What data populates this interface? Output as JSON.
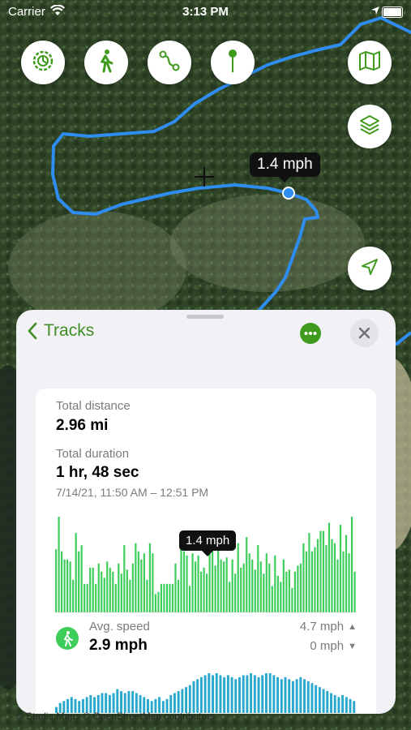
{
  "status_bar": {
    "carrier": "Carrier",
    "time": "3:13 PM"
  },
  "map": {
    "speed_tooltip": "1.4 mph",
    "attribution": "© Stadia Maps © OpenStreetMap contributors",
    "buttons": [
      {
        "name": "settings-icon"
      },
      {
        "name": "walk-icon"
      },
      {
        "name": "route-icon"
      },
      {
        "name": "pin-icon"
      },
      {
        "name": "map-icon"
      },
      {
        "name": "layers-icon"
      },
      {
        "name": "location-arrow-icon"
      }
    ]
  },
  "sheet": {
    "back_label": "Tracks",
    "total_distance_label": "Total distance",
    "total_distance": "2.96 mi",
    "total_duration_label": "Total duration",
    "total_duration": "1 hr, 48 sec",
    "date_range": "7/14/21, 11:50 AM – 12:51 PM",
    "chart_tooltip": "1.4 mph",
    "avg_speed_label": "Avg. speed",
    "avg_speed": "2.9 mph",
    "max_speed": "4.7 mph",
    "min_speed": "0 mph"
  },
  "colors": {
    "accent_green": "#3f8f24",
    "speed_bar": "#3dcd5a",
    "elevation_bar": "#28a8cc"
  },
  "chart_data": [
    {
      "type": "bar",
      "series": [
        {
          "values": [
            3.1,
            4.7,
            3.0,
            2.6,
            2.6,
            2.5,
            1.6,
            3.9,
            3.0,
            3.3,
            1.4,
            1.4,
            2.2,
            2.2,
            1.4,
            2.4,
            2.0,
            1.7,
            2.5,
            2.2,
            2.0,
            1.4,
            2.4,
            1.9,
            3.3,
            2.1,
            1.6,
            2.4,
            3.4,
            3.0,
            2.6,
            2.9,
            1.6,
            3.4,
            2.9,
            0.9,
            1.0,
            1.4,
            1.4,
            1.4,
            1.4,
            1.4,
            2.4,
            1.6,
            3.1,
            3.0,
            2.8,
            1.3,
            2.9,
            2.5,
            2.8,
            2.0,
            2.2,
            1.9,
            3.0,
            3.2,
            2.3,
            3.6,
            2.6,
            2.5,
            2.7,
            1.5,
            2.6,
            1.9,
            3.4,
            2.2,
            2.4,
            3.7,
            2.9,
            2.6,
            2.1,
            3.3,
            2.5,
            1.9,
            2.9,
            2.4,
            1.3,
            2.8,
            1.8,
            1.5,
            2.6,
            2.0,
            2.1,
            1.2,
            2.0,
            2.3,
            2.4,
            3.4,
            3.0,
            3.9,
            3.0,
            3.2,
            3.6,
            4.0,
            4.0,
            3.3,
            4.4,
            3.6,
            3.4,
            2.6,
            4.3,
            3.0,
            3.8,
            2.9,
            4.7,
            2.0
          ]
        }
      ]
    },
    {
      "type": "bar",
      "series": [
        {
          "values": [
            0.15,
            0.25,
            0.3,
            0.35,
            0.4,
            0.35,
            0.3,
            0.35,
            0.4,
            0.45,
            0.4,
            0.45,
            0.5,
            0.5,
            0.45,
            0.5,
            0.6,
            0.55,
            0.5,
            0.55,
            0.55,
            0.5,
            0.45,
            0.4,
            0.35,
            0.3,
            0.35,
            0.4,
            0.3,
            0.35,
            0.45,
            0.5,
            0.55,
            0.6,
            0.65,
            0.7,
            0.8,
            0.85,
            0.9,
            0.95,
            1.0,
            0.95,
            1.0,
            0.95,
            0.9,
            0.95,
            0.9,
            0.85,
            0.9,
            0.95,
            0.95,
            1.0,
            0.95,
            0.9,
            0.95,
            1.0,
            1.0,
            0.95,
            0.9,
            0.85,
            0.9,
            0.85,
            0.8,
            0.85,
            0.9,
            0.85,
            0.8,
            0.75,
            0.7,
            0.65,
            0.6,
            0.55,
            0.5,
            0.45,
            0.4,
            0.45,
            0.4,
            0.35,
            0.3
          ]
        }
      ]
    }
  ]
}
